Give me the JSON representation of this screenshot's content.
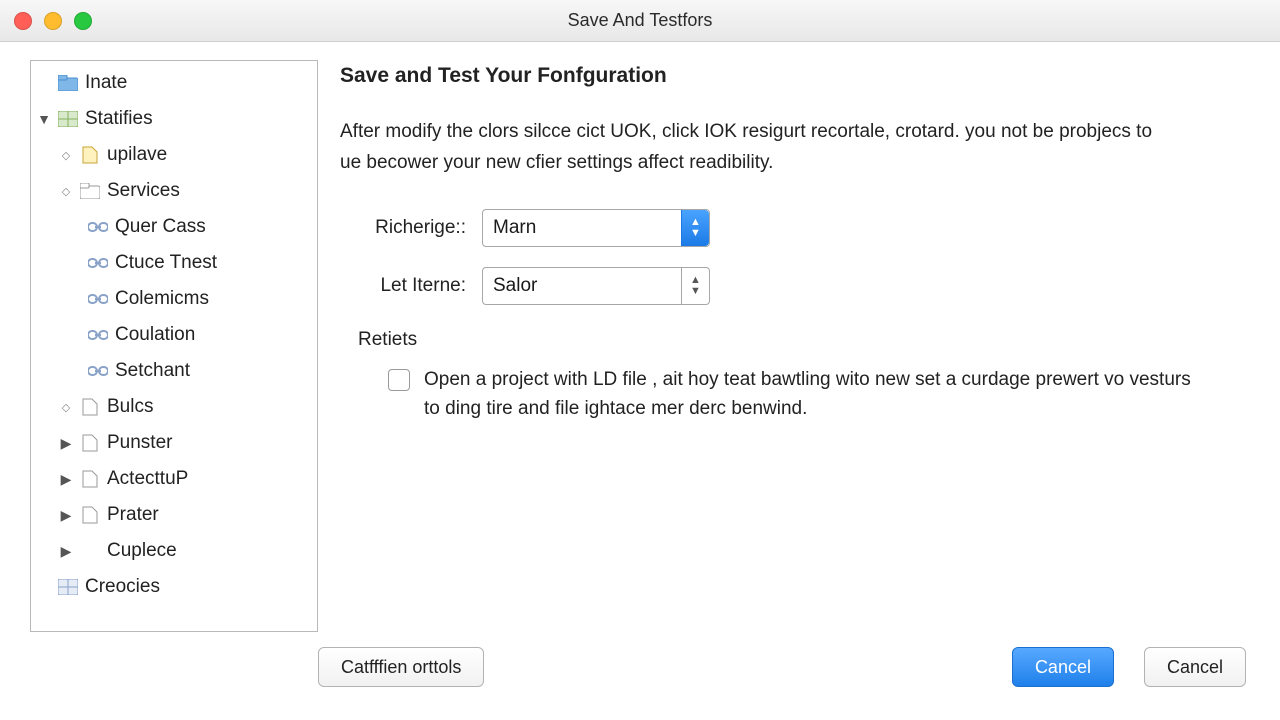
{
  "window": {
    "title": "Save And Testfors"
  },
  "sidebar": {
    "items": [
      {
        "label": "Inate"
      },
      {
        "label": "Statifies"
      },
      {
        "label": "upilave"
      },
      {
        "label": "Services"
      },
      {
        "label": "Quer Cass"
      },
      {
        "label": "Ctuce Tnest"
      },
      {
        "label": "Colemicms"
      },
      {
        "label": "Coulation"
      },
      {
        "label": "Setchant"
      },
      {
        "label": "Bulcs"
      },
      {
        "label": "Punster"
      },
      {
        "label": "ActecttuP"
      },
      {
        "label": "Prater"
      },
      {
        "label": "Cuplece"
      },
      {
        "label": "Creocies"
      }
    ]
  },
  "main": {
    "heading": "Save and Test Your Fonfguration",
    "description": "After modify the clors silcce cict UOK, click IOK resigurt recortale, crotard. you not be probjecs to ue becower your new cfier settings affect readibility.",
    "fields": {
      "richerige": {
        "label": "Richerige::",
        "value": "Marn"
      },
      "letiterne": {
        "label": "Let Iterne:",
        "value": "Salor"
      }
    },
    "retiets": {
      "label": "Retiets",
      "checkbox_text": "Open a project with LD file , ait hoy teat bawtling wito new set a curdage prewert vo vesturs to ding tire and file ightace mer derc benwind."
    }
  },
  "footer": {
    "left_button": "Catfffien orttols",
    "primary_button": "Cancel",
    "secondary_button": "Cancel"
  }
}
